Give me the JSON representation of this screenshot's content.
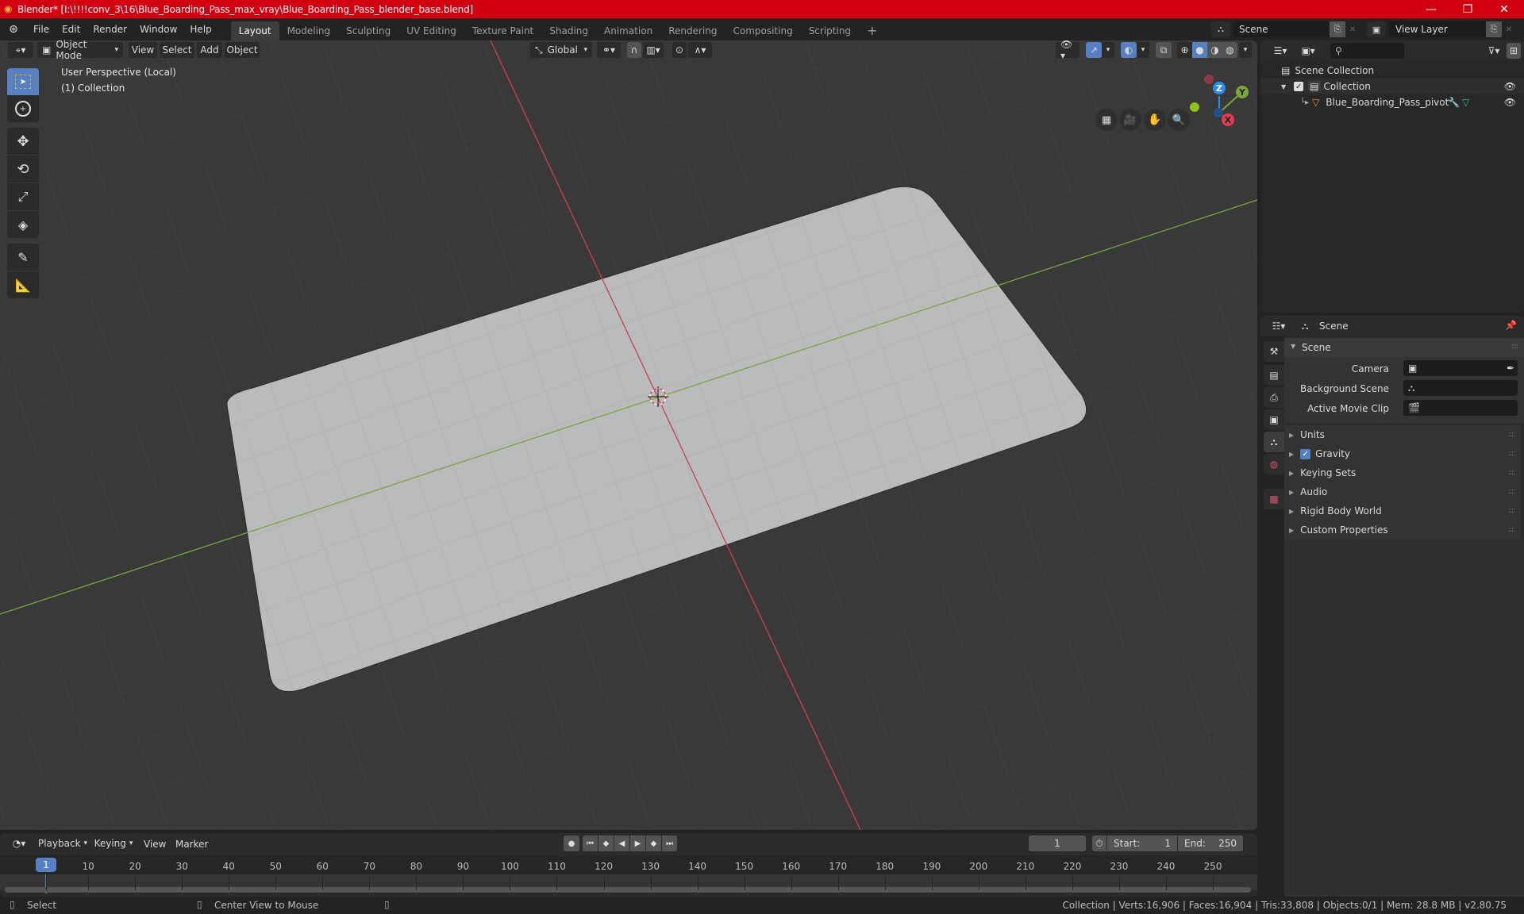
{
  "window": {
    "title": "Blender* [I:\\!!!!conv_3\\16\\Blue_Boarding_Pass_max_vray\\Blue_Boarding_Pass_blender_base.blend]",
    "controls": [
      "minimize",
      "maximize",
      "close"
    ]
  },
  "menubar": {
    "menus": [
      "File",
      "Edit",
      "Render",
      "Window",
      "Help"
    ],
    "workspaces": [
      "Layout",
      "Modeling",
      "Sculpting",
      "UV Editing",
      "Texture Paint",
      "Shading",
      "Animation",
      "Rendering",
      "Compositing",
      "Scripting"
    ],
    "active_workspace": "Layout",
    "add_workspace": "+",
    "scene": "Scene",
    "view_layer": "View Layer"
  },
  "viewport": {
    "mode": "Object Mode",
    "menus": [
      "View",
      "Select",
      "Add",
      "Object"
    ],
    "orientation": "Global",
    "overlay_title": "User Perspective (Local)",
    "overlay_collection": "(1) Collection",
    "gizmo_axes": {
      "x": "X",
      "y": "Y",
      "z": "Z"
    },
    "colors": {
      "x_axis": "#c9404e",
      "y_axis": "#7ca63a",
      "object": "#b8babc",
      "background": "#393939",
      "accent": "#5680c2"
    }
  },
  "tools": [
    "select-box",
    "cursor",
    "move",
    "rotate",
    "scale",
    "transform",
    "annotate",
    "measure"
  ],
  "outliner": {
    "search_placeholder": "",
    "root": "Scene Collection",
    "collection": "Collection",
    "collection_checked": true,
    "object": "Blue_Boarding_Pass_pivot"
  },
  "properties": {
    "context": "Scene",
    "panel_title": "Scene",
    "fields": [
      {
        "label": "Camera",
        "value": ""
      },
      {
        "label": "Background Scene",
        "value": ""
      },
      {
        "label": "Active Movie Clip",
        "value": ""
      }
    ],
    "sections": [
      {
        "label": "Units"
      },
      {
        "label": "Gravity",
        "checkbox": true
      },
      {
        "label": "Keying Sets"
      },
      {
        "label": "Audio"
      },
      {
        "label": "Rigid Body World"
      },
      {
        "label": "Custom Properties"
      }
    ]
  },
  "timeline": {
    "menus": [
      "Playback",
      "Keying",
      "View",
      "Marker"
    ],
    "current_frame": "1",
    "start_label": "Start:",
    "start": "1",
    "end_label": "End:",
    "end": "250",
    "ticks": [
      "1",
      "10",
      "20",
      "30",
      "40",
      "50",
      "60",
      "70",
      "80",
      "90",
      "100",
      "110",
      "120",
      "130",
      "140",
      "150",
      "160",
      "170",
      "180",
      "190",
      "200",
      "210",
      "220",
      "230",
      "240",
      "250"
    ]
  },
  "statusbar": {
    "left_action": "Select",
    "middle_action": "Center View to Mouse",
    "stats": "Collection | Verts:16,906 | Faces:16,904 | Tris:33,808 | Objects:0/1 | Mem: 28.8 MB | v2.80.75"
  }
}
